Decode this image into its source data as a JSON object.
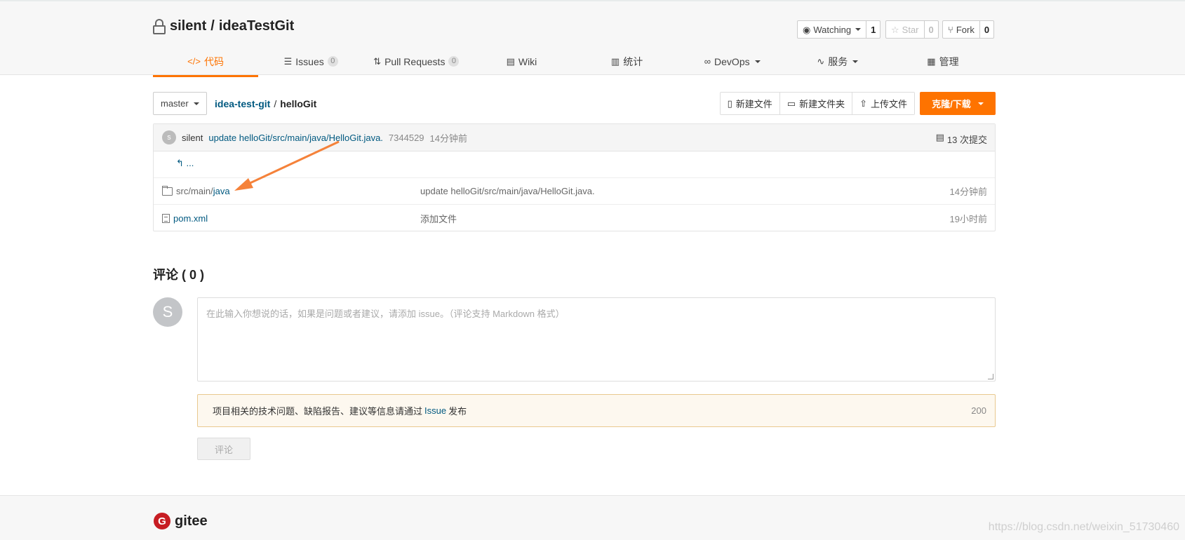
{
  "repo": {
    "owner": "silent",
    "separator": "/",
    "name": "ideaTestGit"
  },
  "actions": {
    "watch_label": "Watching",
    "watch_count": "1",
    "star_label": "Star",
    "star_count": "0",
    "fork_label": "Fork",
    "fork_count": "0"
  },
  "tabs": [
    {
      "icon": "code-icon",
      "label": "代码",
      "badge": ""
    },
    {
      "icon": "issues-icon",
      "label": "Issues",
      "badge": "0"
    },
    {
      "icon": "pull-request-icon",
      "label": "Pull Requests",
      "badge": "0"
    },
    {
      "icon": "wiki-icon",
      "label": "Wiki",
      "badge": ""
    },
    {
      "icon": "stats-icon",
      "label": "统计",
      "badge": ""
    },
    {
      "icon": "devops-icon",
      "label": "DevOps",
      "badge": ""
    },
    {
      "icon": "service-icon",
      "label": "服务",
      "badge": ""
    },
    {
      "icon": "manage-icon",
      "label": "管理",
      "badge": ""
    }
  ],
  "toolbar": {
    "branch": "master",
    "path_root": "idea-test-git",
    "path_sep": "/",
    "path_current": "helloGit",
    "new_file": "新建文件",
    "new_folder": "新建文件夹",
    "upload": "上传文件",
    "clone": "克隆/下载"
  },
  "commit": {
    "avatar_letter": "s",
    "author": "silent",
    "message": "update helloGit/src/main/java/HelloGit.java.",
    "hash": "7344529",
    "time": "14分钟前",
    "count": "13 次提交"
  },
  "files": {
    "back": "...",
    "rows": [
      {
        "type": "folder",
        "prefix": "src/main/",
        "name": "java",
        "message": "update helloGit/src/main/java/HelloGit.java.",
        "time": "14分钟前"
      },
      {
        "type": "file",
        "prefix": "",
        "name": "pom.xml",
        "message": "添加文件",
        "time": "19小时前"
      }
    ]
  },
  "comments": {
    "title": "评论 ( 0 )",
    "avatar_letter": "S",
    "placeholder": "在此输入你想说的话，如果是问题或者建议，请添加 issue。（评论支持 Markdown 格式）",
    "notice_before": "项目相关的技术问题、缺陷报告、建议等信息请通过",
    "notice_link": "Issue",
    "notice_after": "发布",
    "limit": "200",
    "submit": "评论"
  },
  "footer": {
    "logo_letter": "G",
    "brand": "gitee",
    "watermark": "https://blog.csdn.net/weixin_51730460"
  },
  "colors": {
    "accent": "#fe7300",
    "link": "#005980",
    "arrow": "#f5823a"
  }
}
